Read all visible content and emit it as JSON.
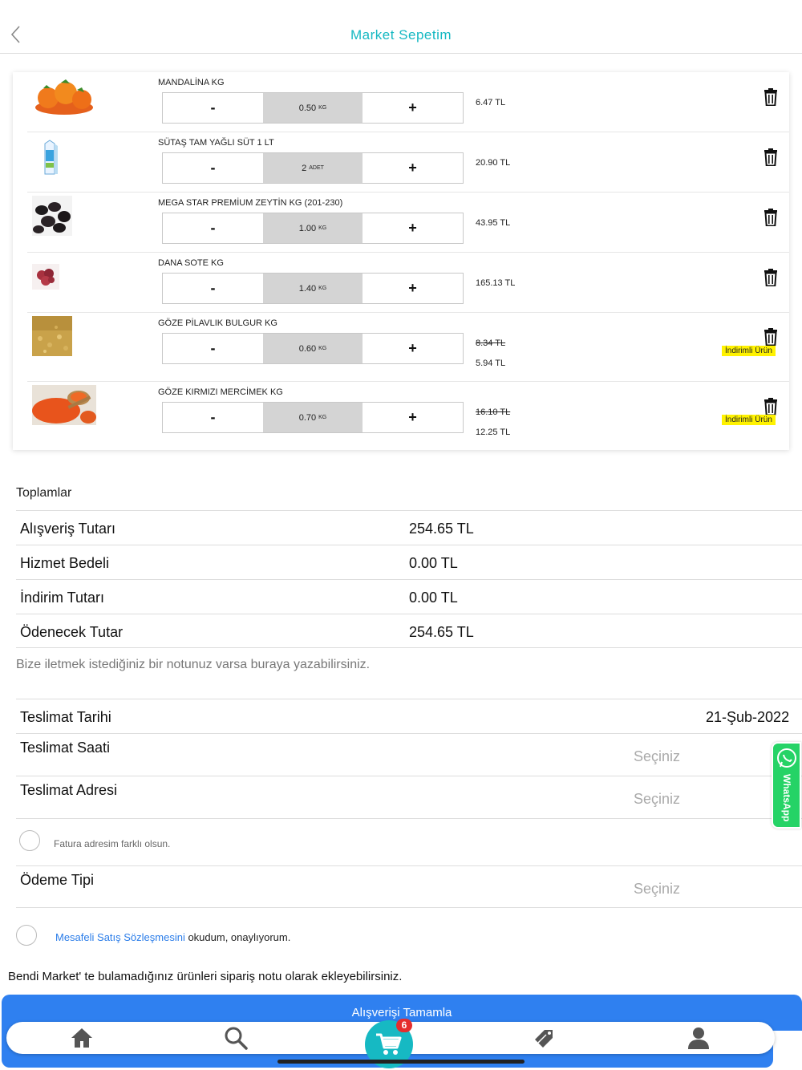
{
  "header": {
    "title": "Market Sepetim"
  },
  "cart": {
    "items": [
      {
        "name": "MANDALİNA KG",
        "qty": "0.50",
        "unit": "KG",
        "price": "6.47 TL"
      },
      {
        "name": "SÜTAŞ TAM YAĞLI SÜT 1 LT",
        "qty": "2",
        "unit": "ADET",
        "price": "20.90 TL"
      },
      {
        "name": "MEGA STAR PREMİUM ZEYTİN KG (201-230)",
        "qty": "1.00",
        "unit": "KG",
        "price": "43.95 TL"
      },
      {
        "name": "DANA SOTE KG",
        "qty": "1.40",
        "unit": "KG",
        "price": "165.13 TL"
      },
      {
        "name": "GÖZE PİLAVLIK BULGUR KG",
        "qty": "0.60",
        "unit": "KG",
        "old_price": "8.34 TL",
        "price": "5.94 TL",
        "badge": "İndirimli Ürün"
      },
      {
        "name": "GÖZE KIRMIZI MERCİMEK KG",
        "qty": "0.70",
        "unit": "KG",
        "old_price": "16.10 TL",
        "price": "12.25 TL",
        "badge": "İndirimli Ürün"
      }
    ],
    "minus_label": "-",
    "plus_label": "+"
  },
  "totals": {
    "heading": "Toplamlar",
    "rows": [
      {
        "label": "Alışveriş Tutarı",
        "value": "254.65 TL"
      },
      {
        "label": "Hizmet Bedeli",
        "value": "0.00 TL"
      },
      {
        "label": "İndirim Tutarı",
        "value": "0.00 TL"
      },
      {
        "label": "Ödenecek Tutar",
        "value": "254.65 TL"
      }
    ]
  },
  "note_placeholder": "Bize iletmek istediğiniz bir notunuz varsa buraya yazabilirsiniz.",
  "delivery": {
    "date_label": "Teslimat Tarihi",
    "date_value": "21-Şub-2022",
    "time_label": "Teslimat Saati",
    "time_placeholder": "Seçiniz",
    "address_label": "Teslimat Adresi",
    "address_placeholder": "Seçiniz",
    "invoice_label": "Fatura adresim farklı olsun.",
    "payment_label": "Ödeme Tipi",
    "payment_placeholder": "Seçiniz"
  },
  "agreement": {
    "link": "Mesafeli Satış Sözleşmesini",
    "text": " okudum, onaylıyorum."
  },
  "footer_note": "Bendi Market' te bulamadığınız ürünleri sipariş notu olarak ekleyebilirsiniz.",
  "complete_button": "Alışverişi Tamamla",
  "tabbar": {
    "cart_badge": "6",
    "icons": [
      "home-icon",
      "search-icon",
      "cart-icon",
      "tag-icon",
      "user-icon"
    ]
  },
  "whatsapp": {
    "label": "WhatsApp"
  },
  "colors": {
    "accent": "#16b9c3",
    "primary_button": "#2f80f0",
    "discount_badge": "#fff200",
    "whatsapp": "#25d366",
    "badge_red": "#e52d2d"
  }
}
